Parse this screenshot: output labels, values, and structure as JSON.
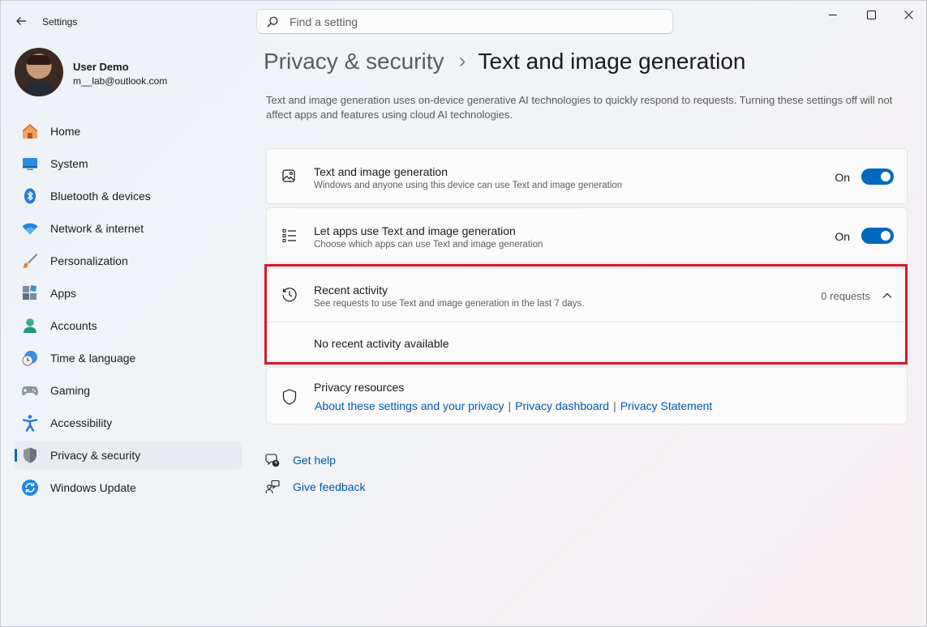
{
  "app": {
    "title": "Settings"
  },
  "search": {
    "placeholder": "Find a setting"
  },
  "window_controls": [
    "minimize-icon",
    "maximize-icon",
    "close-icon"
  ],
  "user": {
    "name": "User Demo",
    "email": "m__lab@outlook.com"
  },
  "sidebar": {
    "active": "Privacy & security",
    "items": [
      {
        "label": "Home",
        "icon": "home-icon"
      },
      {
        "label": "System",
        "icon": "system-icon"
      },
      {
        "label": "Bluetooth & devices",
        "icon": "bluetooth-icon"
      },
      {
        "label": "Network & internet",
        "icon": "wifi-icon"
      },
      {
        "label": "Personalization",
        "icon": "brush-icon"
      },
      {
        "label": "Apps",
        "icon": "apps-icon"
      },
      {
        "label": "Accounts",
        "icon": "accounts-icon"
      },
      {
        "label": "Time & language",
        "icon": "globe-clock-icon"
      },
      {
        "label": "Gaming",
        "icon": "gamepad-icon"
      },
      {
        "label": "Accessibility",
        "icon": "accessibility-icon"
      },
      {
        "label": "Privacy & security",
        "icon": "shield-icon"
      },
      {
        "label": "Windows Update",
        "icon": "update-icon"
      }
    ]
  },
  "breadcrumb": {
    "parent": "Privacy & security",
    "current": "Text and image generation"
  },
  "description": "Text and image generation uses on-device generative AI technologies to quickly respond to requests. Turning these settings off will not affect apps and features using cloud AI technologies.",
  "settings": [
    {
      "title": "Text and image generation",
      "subtitle": "Windows and anyone using this device can use Text and image generation",
      "state": "On",
      "icon": "image-edit-icon"
    },
    {
      "title": "Let apps use Text and image generation",
      "subtitle": "Choose which apps can use Text and image generation",
      "state": "On",
      "icon": "list-icon"
    }
  ],
  "recent_activity": {
    "title": "Recent activity",
    "subtitle": "See requests to use Text and image generation in the last 7 days.",
    "count": "0 requests",
    "empty": "No recent activity available",
    "icon": "history-icon"
  },
  "privacy_resources": {
    "title": "Privacy resources",
    "links": [
      "About these settings and your privacy",
      "Privacy dashboard",
      "Privacy Statement"
    ],
    "icon": "shield-outline-icon"
  },
  "help": {
    "get_help": "Get help",
    "feedback": "Give feedback"
  },
  "colors": {
    "accent": "#0067c0",
    "link": "#0058b0",
    "highlight": "#d7182a"
  }
}
